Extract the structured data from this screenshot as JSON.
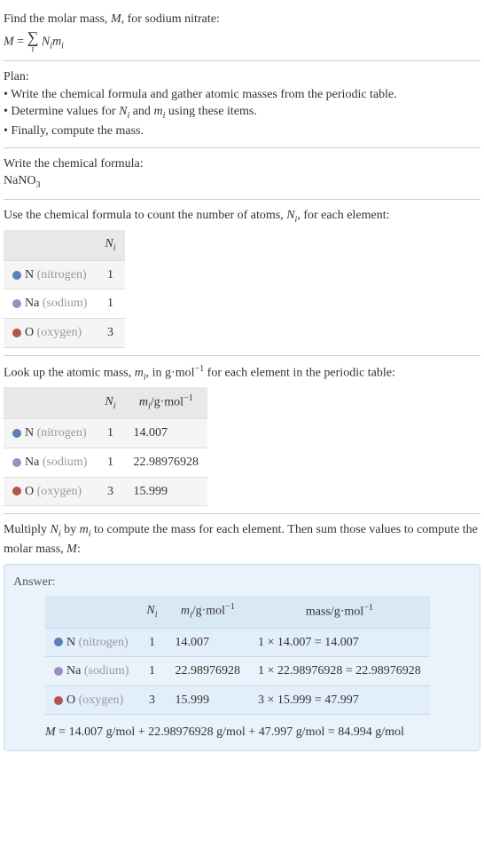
{
  "intro": {
    "line1": "Find the molar mass, ",
    "var_M": "M",
    "line1_end": ", for sodium nitrate:",
    "eq_lhs": "M",
    "eq_eq": " = ",
    "sigma": "∑",
    "sigma_sub": "i",
    "term_N": "N",
    "term_m": "m",
    "sub_i": "i"
  },
  "plan": {
    "title": "Plan:",
    "items": [
      "Write the chemical formula and gather atomic masses from the periodic table.",
      "Determine values for Nᵢ and mᵢ using these items.",
      "Finally, compute the mass."
    ],
    "item1": "Write the chemical formula and gather atomic masses from the periodic table.",
    "item2_a": "Determine values for ",
    "item2_b": " and ",
    "item2_c": " using these items.",
    "item3": "Finally, compute the mass."
  },
  "formula_section": {
    "title": "Write the chemical formula:",
    "formula_a": "NaNO",
    "formula_sub": "3"
  },
  "count_section": {
    "intro_a": "Use the chemical formula to count the number of atoms, ",
    "intro_b": ", for each element:"
  },
  "table1": {
    "header_N": "N",
    "rows": [
      {
        "el_sym": "N",
        "el_name": "(nitrogen)",
        "n": "1"
      },
      {
        "el_sym": "Na",
        "el_name": "(sodium)",
        "n": "1"
      },
      {
        "el_sym": "O",
        "el_name": "(oxygen)",
        "n": "3"
      }
    ]
  },
  "mass_section": {
    "intro_a": "Look up the atomic mass, ",
    "intro_b": ", in g·mol",
    "intro_c": " for each element in the periodic table:"
  },
  "table2": {
    "header_m": "m",
    "unit_a": "/g·mol",
    "neg1": "−1",
    "rows": [
      {
        "el_sym": "N",
        "el_name": "(nitrogen)",
        "n": "1",
        "m": "14.007"
      },
      {
        "el_sym": "Na",
        "el_name": "(sodium)",
        "n": "1",
        "m": "22.98976928"
      },
      {
        "el_sym": "O",
        "el_name": "(oxygen)",
        "n": "3",
        "m": "15.999"
      }
    ]
  },
  "multiply_section": {
    "text_a": "Multiply ",
    "text_b": " by ",
    "text_c": " to compute the mass for each element. Then sum those values to compute the molar mass, ",
    "text_d": ":"
  },
  "answer": {
    "label": "Answer:",
    "header_mass_a": "mass/g·mol",
    "rows": [
      {
        "el_sym": "N",
        "el_name": "(nitrogen)",
        "n": "1",
        "m": "14.007",
        "calc": "1 × 14.007 = 14.007"
      },
      {
        "el_sym": "Na",
        "el_name": "(sodium)",
        "n": "1",
        "m": "22.98976928",
        "calc": "1 × 22.98976928 = 22.98976928"
      },
      {
        "el_sym": "O",
        "el_name": "(oxygen)",
        "n": "3",
        "m": "15.999",
        "calc": "3 × 15.999 = 47.997"
      }
    ],
    "final_a": "M",
    "final_b": " = 14.007 g/mol + 22.98976928 g/mol + 47.997 g/mol = 84.994 g/mol"
  }
}
